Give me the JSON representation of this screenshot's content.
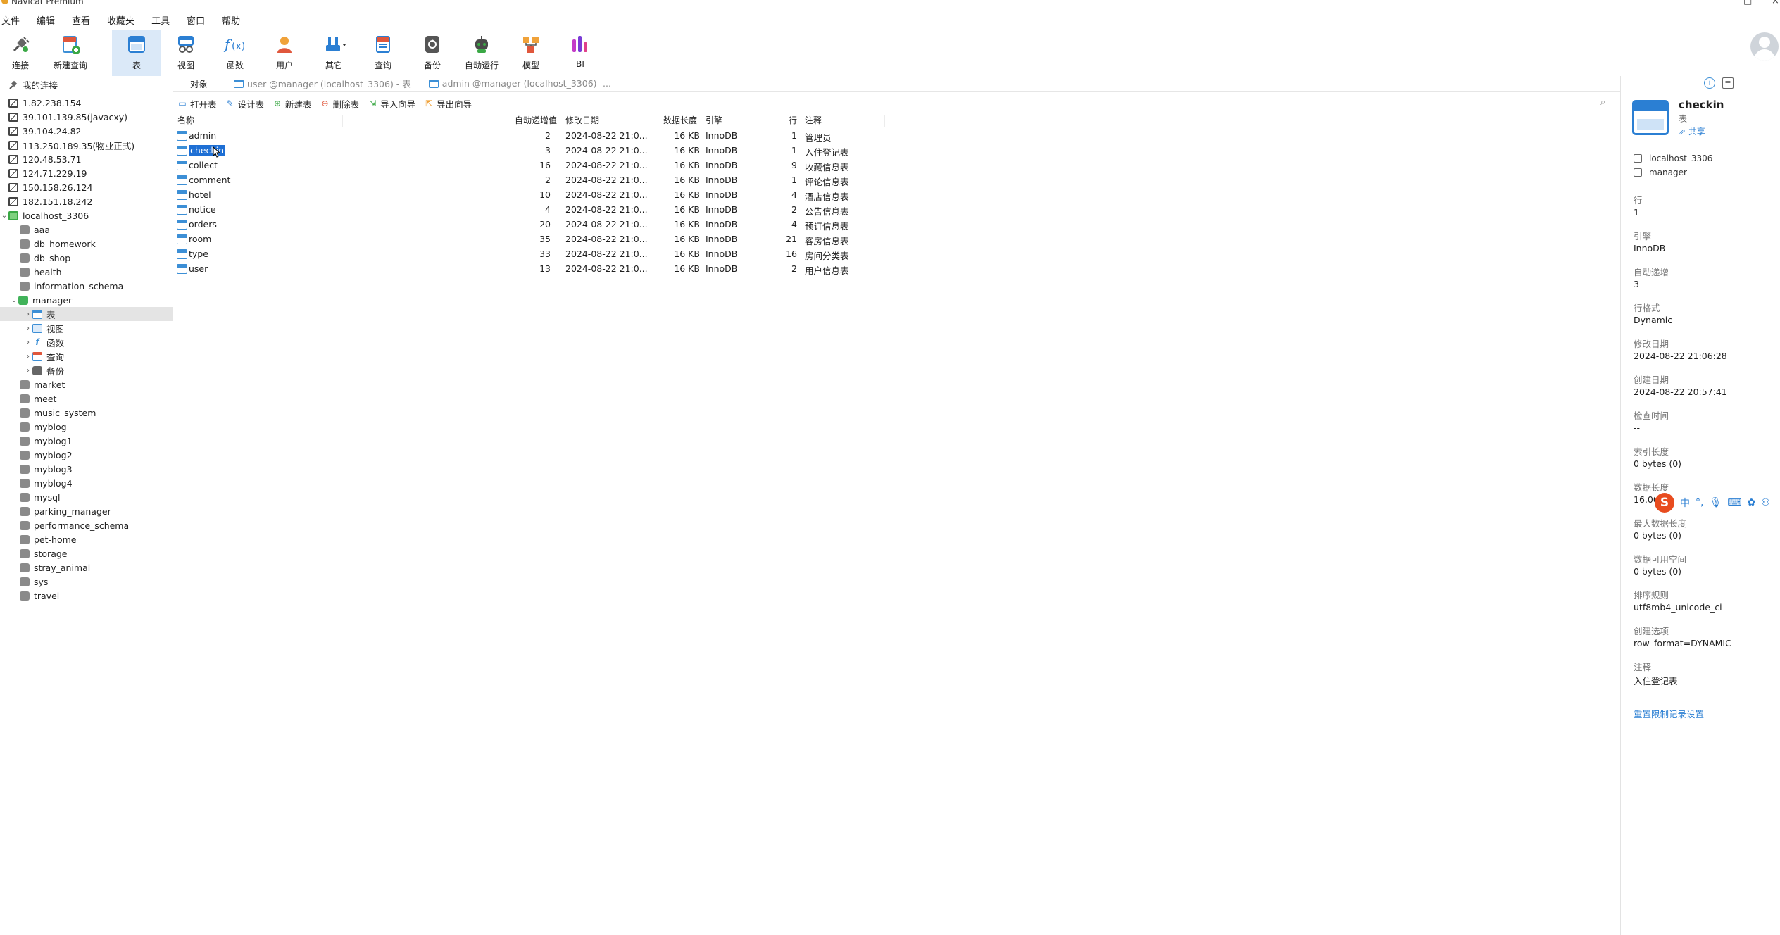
{
  "window": {
    "title": "Navicat Premium",
    "min": "–",
    "max": "□",
    "close": "×"
  },
  "menu": [
    "文件",
    "编辑",
    "查看",
    "收藏夹",
    "工具",
    "窗口",
    "帮助"
  ],
  "toolbar": {
    "connect": "连接",
    "new_query": "新建查询",
    "table": "表",
    "view": "视图",
    "function": "函数",
    "user": "用户",
    "other": "其它",
    "query": "查询",
    "backup": "备份",
    "automation": "自动运行",
    "model": "模型",
    "bi": "BI"
  },
  "sidebar": {
    "root": "我的连接",
    "connections": [
      "1.82.238.154",
      "39.101.139.85(javacxy)",
      "39.104.24.82",
      "113.250.189.35(物业正式)",
      "120.48.53.71",
      "124.71.229.19",
      "150.158.26.124",
      "182.151.18.242"
    ],
    "active_connection": "localhost_3306",
    "databases_before": [
      "aaa",
      "db_homework",
      "db_shop",
      "health",
      "information_schema"
    ],
    "open_database": "manager",
    "database_children": [
      "表",
      "视图",
      "函数",
      "查询",
      "备份"
    ],
    "databases_after": [
      "market",
      "meet",
      "music_system",
      "myblog",
      "myblog1",
      "myblog2",
      "myblog3",
      "myblog4",
      "mysql",
      "parking_manager",
      "performance_schema",
      "pet-home",
      "storage",
      "stray_animal",
      "sys",
      "travel"
    ]
  },
  "tabs": {
    "objects": "对象",
    "tab1": "user @manager (localhost_3306) - 表",
    "tab2": "admin @manager (localhost_3306) -..."
  },
  "object_toolbar": {
    "open": "打开表",
    "design": "设计表",
    "new": "新建表",
    "delete": "删除表",
    "import": "导入向导",
    "export": "导出向导"
  },
  "table_list": {
    "columns": {
      "name": "名称",
      "auto_increment": "自动递增值",
      "modified": "修改日期",
      "data_length": "数据长度",
      "engine": "引擎",
      "rows": "行",
      "comment": "注释"
    },
    "selected_index": 1,
    "rows": [
      {
        "name": "admin",
        "auto_increment": "2",
        "modified": "2024-08-22 21:0...",
        "data_length": "16 KB",
        "engine": "InnoDB",
        "rows": "1",
        "comment": "管理员"
      },
      {
        "name": "checkin",
        "auto_increment": "3",
        "modified": "2024-08-22 21:0...",
        "data_length": "16 KB",
        "engine": "InnoDB",
        "rows": "1",
        "comment": "入住登记表"
      },
      {
        "name": "collect",
        "auto_increment": "16",
        "modified": "2024-08-22 21:0...",
        "data_length": "16 KB",
        "engine": "InnoDB",
        "rows": "9",
        "comment": "收藏信息表"
      },
      {
        "name": "comment",
        "auto_increment": "2",
        "modified": "2024-08-22 21:0...",
        "data_length": "16 KB",
        "engine": "InnoDB",
        "rows": "1",
        "comment": "评论信息表"
      },
      {
        "name": "hotel",
        "auto_increment": "10",
        "modified": "2024-08-22 21:0...",
        "data_length": "16 KB",
        "engine": "InnoDB",
        "rows": "4",
        "comment": "酒店信息表"
      },
      {
        "name": "notice",
        "auto_increment": "4",
        "modified": "2024-08-22 21:0...",
        "data_length": "16 KB",
        "engine": "InnoDB",
        "rows": "2",
        "comment": "公告信息表"
      },
      {
        "name": "orders",
        "auto_increment": "20",
        "modified": "2024-08-22 21:0...",
        "data_length": "16 KB",
        "engine": "InnoDB",
        "rows": "4",
        "comment": "预订信息表"
      },
      {
        "name": "room",
        "auto_increment": "35",
        "modified": "2024-08-22 21:0...",
        "data_length": "16 KB",
        "engine": "InnoDB",
        "rows": "21",
        "comment": "客房信息表"
      },
      {
        "name": "type",
        "auto_increment": "33",
        "modified": "2024-08-22 21:0...",
        "data_length": "16 KB",
        "engine": "InnoDB",
        "rows": "16",
        "comment": "房间分类表"
      },
      {
        "name": "user",
        "auto_increment": "13",
        "modified": "2024-08-22 21:0...",
        "data_length": "16 KB",
        "engine": "InnoDB",
        "rows": "2",
        "comment": "用户信息表"
      }
    ]
  },
  "info_panel": {
    "name": "checkin",
    "type": "表",
    "share": "共享",
    "connection": "localhost_3306",
    "database": "manager",
    "props": [
      {
        "label": "行",
        "value": "1"
      },
      {
        "label": "引擎",
        "value": "InnoDB"
      },
      {
        "label": "自动递增",
        "value": "3"
      },
      {
        "label": "行格式",
        "value": "Dynamic"
      },
      {
        "label": "修改日期",
        "value": "2024-08-22 21:06:28"
      },
      {
        "label": "创建日期",
        "value": "2024-08-22 20:57:41"
      },
      {
        "label": "检查时间",
        "value": "--"
      },
      {
        "label": "索引长度",
        "value": "0 bytes (0)"
      },
      {
        "label": "数据长度",
        "value": "16.00"
      },
      {
        "label": "最大数据长度",
        "value": "0 bytes (0)"
      },
      {
        "label": "数据可用空间",
        "value": "0 bytes (0)"
      },
      {
        "label": "排序规则",
        "value": "utf8mb4_unicode_ci"
      },
      {
        "label": "创建选项",
        "value": "row_format=DYNAMIC"
      },
      {
        "label": "注释",
        "value": "入住登记表"
      }
    ],
    "reset_link": "重置限制记录设置"
  },
  "ime": {
    "logo": "S",
    "mode": "中"
  },
  "colors": {
    "accent": "#2b7fd3",
    "selection": "#1e6fd4",
    "active_tool": "#dbe9f8"
  }
}
